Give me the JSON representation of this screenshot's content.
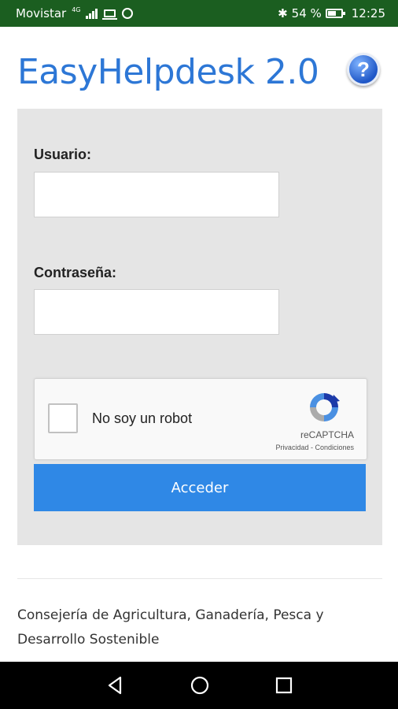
{
  "status_bar": {
    "carrier": "Movistar",
    "network": "4G",
    "battery": "54 %",
    "time": "12:25",
    "icons": [
      "signal-icon",
      "laptop-icon",
      "whatsapp-icon",
      "bluetooth-icon",
      "battery-icon"
    ]
  },
  "header": {
    "title": "EasyHelpdesk 2.0",
    "help_label": "?"
  },
  "form": {
    "username_label": "Usuario:",
    "username_value": "",
    "password_label": "Contraseña:",
    "password_value": "",
    "captcha": {
      "label": "No soy un robot",
      "checked": false,
      "brand": "reCAPTCHA",
      "terms": "Privacidad - Condiciones"
    },
    "submit_label": "Acceder"
  },
  "footer": {
    "text": "Consejería de Agricultura, Ganadería, Pesca y Desarrollo Sostenible"
  },
  "colors": {
    "status_bar": "#1b5e20",
    "title": "#2d77d6",
    "button": "#2f88e6",
    "panel": "#e5e5e5"
  },
  "nav_bar": {
    "icons": [
      "back-icon",
      "home-icon",
      "recents-icon"
    ]
  }
}
